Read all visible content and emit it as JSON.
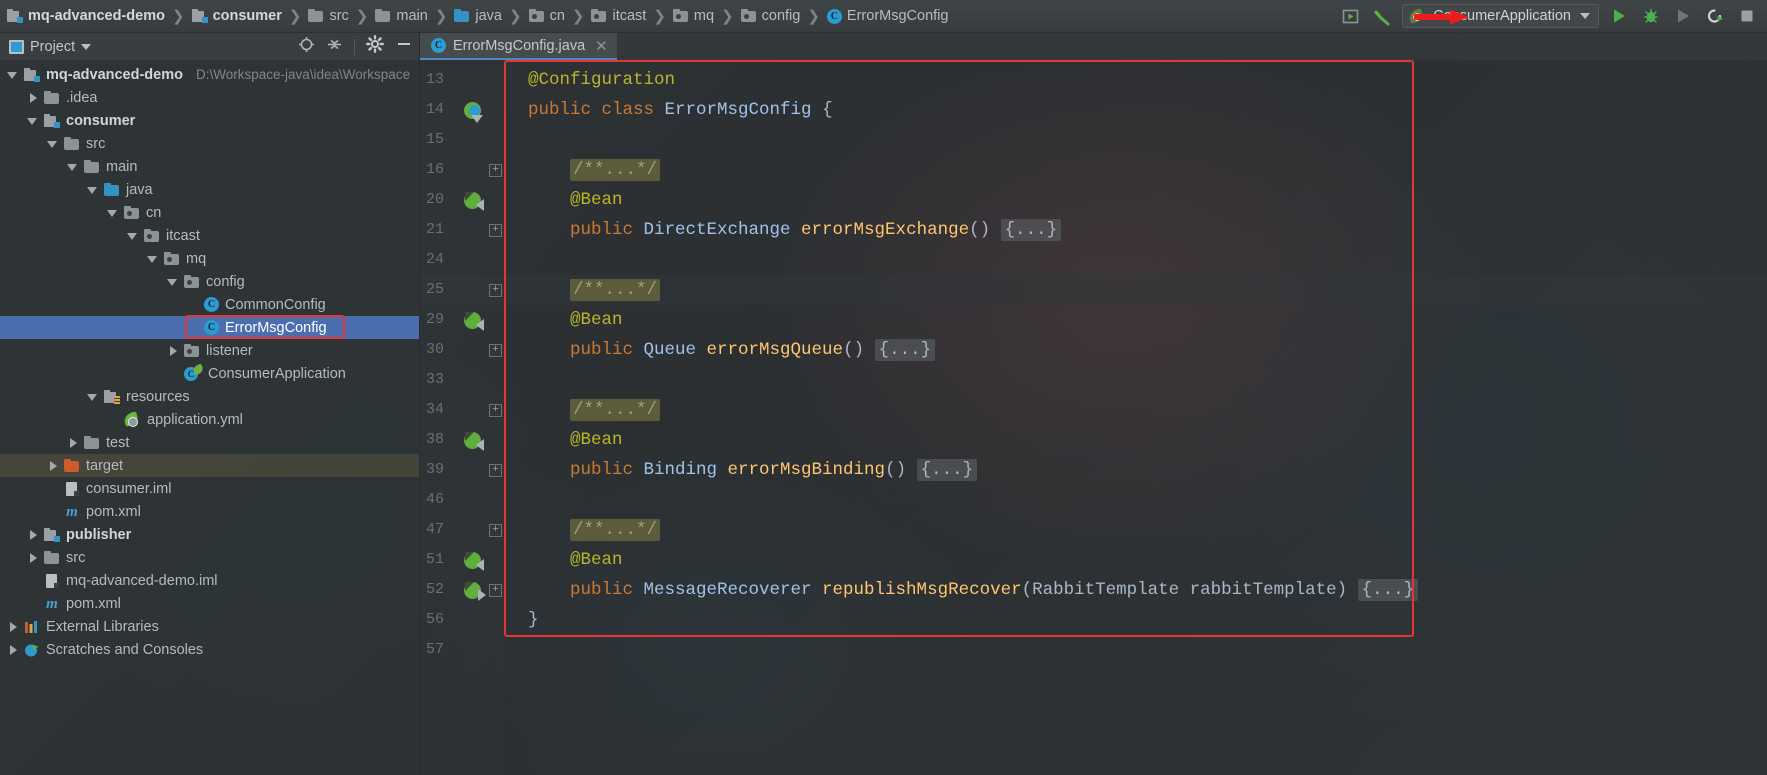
{
  "window": {
    "theme_bg": "#3c3f41",
    "accent": "#4b6eaf",
    "annotation_color": "#e53535"
  },
  "breadcrumb": {
    "items": [
      {
        "label": "mq-advanced-demo",
        "icon": "module-icon",
        "bold": true
      },
      {
        "label": "consumer",
        "icon": "module-icon",
        "bold": true
      },
      {
        "label": "src",
        "icon": "folder-icon",
        "bold": false
      },
      {
        "label": "main",
        "icon": "folder-icon",
        "bold": false
      },
      {
        "label": "java",
        "icon": "source-folder-icon",
        "bold": false
      },
      {
        "label": "cn",
        "icon": "package-icon",
        "bold": false
      },
      {
        "label": "itcast",
        "icon": "package-icon",
        "bold": false
      },
      {
        "label": "mq",
        "icon": "package-icon",
        "bold": false
      },
      {
        "label": "config",
        "icon": "package-icon",
        "bold": false
      },
      {
        "label": "ErrorMsgConfig",
        "icon": "java-class-icon",
        "bold": false
      }
    ],
    "separator": "❯"
  },
  "toolbar": {
    "icons": [
      {
        "name": "search-everywhere-icon",
        "glyph": "▶"
      },
      {
        "name": "build-hammer-icon",
        "glyph": "↖"
      }
    ],
    "run_configuration": {
      "name": "ConsumerApplication",
      "icon": "spring-boot-icon",
      "dropdown_caret": "▼"
    },
    "buttons": [
      {
        "name": "run-button",
        "glyph": "▶",
        "color": "#4caf50"
      },
      {
        "name": "debug-button",
        "glyph": "🐞",
        "color": "#4caf50"
      },
      {
        "name": "run-with-coverage-button",
        "glyph": "▶",
        "color": "#7a7f82"
      },
      {
        "name": "profiler-button",
        "glyph": "↻",
        "color": "#cfd4d7"
      },
      {
        "name": "stop-button",
        "glyph": "■",
        "color": "#9aa0a4"
      }
    ],
    "annotation": "red-arrow-pointing-to-run-button"
  },
  "project_panel": {
    "title": "Project",
    "header_icons": [
      {
        "name": "locate-target-icon"
      },
      {
        "name": "collapse-all-icon"
      },
      {
        "name": "gear-settings-icon"
      },
      {
        "name": "hide-panel-icon"
      }
    ],
    "tree": [
      {
        "label": "mq-advanced-demo",
        "path_hint": "D:\\Workspace-java\\idea\\Workspace",
        "depth": 0,
        "icon": "module-icon",
        "state": "open",
        "bold": true,
        "selected": false
      },
      {
        "label": ".idea",
        "depth": 1,
        "icon": "folder-icon",
        "state": "closed",
        "bold": false,
        "selected": false
      },
      {
        "label": "consumer",
        "depth": 1,
        "icon": "module-icon",
        "state": "open",
        "bold": true,
        "selected": false
      },
      {
        "label": "src",
        "depth": 2,
        "icon": "folder-icon",
        "state": "open",
        "bold": false,
        "selected": false
      },
      {
        "label": "main",
        "depth": 3,
        "icon": "folder-icon",
        "state": "open",
        "bold": false,
        "selected": false
      },
      {
        "label": "java",
        "depth": 4,
        "icon": "source-folder-icon",
        "state": "open",
        "bold": false,
        "selected": false
      },
      {
        "label": "cn",
        "depth": 5,
        "icon": "package-icon",
        "state": "open",
        "bold": false,
        "selected": false
      },
      {
        "label": "itcast",
        "depth": 6,
        "icon": "package-icon",
        "state": "open",
        "bold": false,
        "selected": false
      },
      {
        "label": "mq",
        "depth": 7,
        "icon": "package-icon",
        "state": "open",
        "bold": false,
        "selected": false
      },
      {
        "label": "config",
        "depth": 8,
        "icon": "package-icon",
        "state": "open",
        "bold": false,
        "selected": false
      },
      {
        "label": "CommonConfig",
        "depth": 9,
        "icon": "java-class-icon",
        "state": "leaf",
        "bold": false,
        "selected": false
      },
      {
        "label": "ErrorMsgConfig",
        "depth": 9,
        "icon": "java-class-icon",
        "state": "leaf",
        "bold": false,
        "selected": true,
        "annotated": true
      },
      {
        "label": "listener",
        "depth": 8,
        "icon": "package-icon",
        "state": "closed",
        "bold": false,
        "selected": false
      },
      {
        "label": "ConsumerApplication",
        "depth": 8,
        "icon": "spring-class-icon",
        "state": "leaf",
        "bold": false,
        "selected": false
      },
      {
        "label": "resources",
        "depth": 4,
        "icon": "resources-folder-icon",
        "state": "open",
        "bold": false,
        "selected": false
      },
      {
        "label": "application.yml",
        "depth": 5,
        "icon": "spring-yaml-icon",
        "state": "leaf",
        "bold": false,
        "selected": false
      },
      {
        "label": "test",
        "depth": 3,
        "icon": "folder-icon",
        "state": "closed",
        "bold": false,
        "selected": false
      },
      {
        "label": "target",
        "depth": 2,
        "icon": "excluded-folder-icon",
        "state": "closed",
        "bold": false,
        "selected": false,
        "hovered": true
      },
      {
        "label": "consumer.iml",
        "depth": 2,
        "icon": "iml-file-icon",
        "state": "leaf",
        "bold": false,
        "selected": false
      },
      {
        "label": "pom.xml",
        "depth": 2,
        "icon": "maven-icon",
        "state": "leaf",
        "bold": false,
        "selected": false
      },
      {
        "label": "publisher",
        "depth": 1,
        "icon": "module-icon",
        "state": "closed",
        "bold": true,
        "selected": false
      },
      {
        "label": "src",
        "depth": 1,
        "icon": "folder-icon",
        "state": "closed",
        "bold": false,
        "selected": false
      },
      {
        "label": "mq-advanced-demo.iml",
        "depth": 1,
        "icon": "iml-file-icon",
        "state": "leaf",
        "bold": false,
        "selected": false
      },
      {
        "label": "pom.xml",
        "depth": 1,
        "icon": "maven-icon",
        "state": "leaf",
        "bold": false,
        "selected": false
      },
      {
        "label": "External Libraries",
        "depth": 0,
        "icon": "libraries-icon",
        "state": "closed",
        "bold": false,
        "selected": false
      },
      {
        "label": "Scratches and Consoles",
        "depth": 0,
        "icon": "scratches-icon",
        "state": "closed",
        "bold": false,
        "selected": false
      }
    ]
  },
  "editor": {
    "tabs": [
      {
        "label": "ErrorMsgConfig.java",
        "icon": "java-class-icon",
        "active": true,
        "close_glyph": "✕"
      }
    ],
    "annotation": "red-rectangle-around-code-block",
    "lines": [
      {
        "num": "13",
        "gutter": "",
        "fold": false,
        "bulb": false,
        "highlight": false,
        "indent": 0,
        "tokens": [
          {
            "t": "@Configuration",
            "c": "ann"
          }
        ]
      },
      {
        "num": "14",
        "gutter": "run-class-icon",
        "fold": false,
        "bulb": false,
        "highlight": false,
        "indent": 0,
        "tokens": [
          {
            "t": "public ",
            "c": "kw"
          },
          {
            "t": "class ",
            "c": "kw"
          },
          {
            "t": "ErrorMsgConfig",
            "c": "cls"
          },
          {
            "t": " {",
            "c": "pun"
          }
        ]
      },
      {
        "num": "15",
        "gutter": "",
        "fold": false,
        "bulb": false,
        "highlight": false,
        "indent": 0,
        "tokens": []
      },
      {
        "num": "16",
        "gutter": "",
        "fold": true,
        "bulb": false,
        "highlight": false,
        "indent": 1,
        "tokens": [
          {
            "t": "/**...*/",
            "c": "fold-ph"
          }
        ]
      },
      {
        "num": "20",
        "gutter": "nav-left-icon",
        "fold": false,
        "bulb": false,
        "highlight": false,
        "indent": 1,
        "tokens": [
          {
            "t": "@Bean",
            "c": "ann"
          }
        ]
      },
      {
        "num": "21",
        "gutter": "",
        "fold": true,
        "bulb": false,
        "highlight": false,
        "indent": 1,
        "tokens": [
          {
            "t": "public ",
            "c": "kw"
          },
          {
            "t": "DirectExchange ",
            "c": "cls"
          },
          {
            "t": "errorMsgExchange",
            "c": "mth"
          },
          {
            "t": "() ",
            "c": "pun"
          },
          {
            "t": "{...}",
            "c": "fold-brace"
          }
        ]
      },
      {
        "num": "24",
        "gutter": "",
        "fold": false,
        "bulb": false,
        "highlight": false,
        "indent": 0,
        "tokens": []
      },
      {
        "num": "25",
        "gutter": "",
        "fold": true,
        "bulb": true,
        "highlight": true,
        "indent": 1,
        "tokens": [
          {
            "t": "/**...*/",
            "c": "fold-ph"
          }
        ]
      },
      {
        "num": "29",
        "gutter": "nav-left-icon",
        "fold": false,
        "bulb": false,
        "highlight": false,
        "indent": 1,
        "tokens": [
          {
            "t": "@Bean",
            "c": "ann"
          }
        ]
      },
      {
        "num": "30",
        "gutter": "",
        "fold": true,
        "bulb": false,
        "highlight": false,
        "indent": 1,
        "tokens": [
          {
            "t": "public ",
            "c": "kw"
          },
          {
            "t": "Queue ",
            "c": "cls"
          },
          {
            "t": "errorMsgQueue",
            "c": "mth"
          },
          {
            "t": "() ",
            "c": "pun"
          },
          {
            "t": "{...}",
            "c": "fold-brace"
          }
        ]
      },
      {
        "num": "33",
        "gutter": "",
        "fold": false,
        "bulb": false,
        "highlight": false,
        "indent": 0,
        "tokens": []
      },
      {
        "num": "34",
        "gutter": "",
        "fold": true,
        "bulb": false,
        "highlight": false,
        "indent": 1,
        "tokens": [
          {
            "t": "/**...*/",
            "c": "fold-ph"
          }
        ]
      },
      {
        "num": "38",
        "gutter": "nav-left-icon",
        "fold": false,
        "bulb": false,
        "highlight": false,
        "indent": 1,
        "tokens": [
          {
            "t": "@Bean",
            "c": "ann"
          }
        ]
      },
      {
        "num": "39",
        "gutter": "",
        "fold": true,
        "bulb": false,
        "highlight": false,
        "indent": 1,
        "tokens": [
          {
            "t": "public ",
            "c": "kw"
          },
          {
            "t": "Binding ",
            "c": "cls"
          },
          {
            "t": "errorMsgBinding",
            "c": "mth"
          },
          {
            "t": "() ",
            "c": "pun"
          },
          {
            "t": "{...}",
            "c": "fold-brace"
          }
        ]
      },
      {
        "num": "46",
        "gutter": "",
        "fold": false,
        "bulb": false,
        "highlight": false,
        "indent": 0,
        "tokens": []
      },
      {
        "num": "47",
        "gutter": "",
        "fold": true,
        "bulb": false,
        "highlight": false,
        "indent": 1,
        "tokens": [
          {
            "t": "/**...*/",
            "c": "fold-ph"
          }
        ]
      },
      {
        "num": "51",
        "gutter": "nav-left-icon",
        "fold": false,
        "bulb": false,
        "highlight": false,
        "indent": 1,
        "tokens": [
          {
            "t": "@Bean",
            "c": "ann"
          }
        ]
      },
      {
        "num": "52",
        "gutter": "nav-right-icon",
        "fold": true,
        "bulb": false,
        "highlight": false,
        "indent": 1,
        "tokens": [
          {
            "t": "public ",
            "c": "kw"
          },
          {
            "t": "MessageRecoverer ",
            "c": "cls"
          },
          {
            "t": "republishMsgRecover",
            "c": "mth"
          },
          {
            "t": "(RabbitTemplate rabbitTemplate) ",
            "c": "pun"
          },
          {
            "t": "{...}",
            "c": "fold-brace"
          }
        ]
      },
      {
        "num": "56",
        "gutter": "",
        "fold": false,
        "bulb": false,
        "highlight": false,
        "indent": 0,
        "tokens": [
          {
            "t": "}",
            "c": "pun"
          }
        ]
      },
      {
        "num": "57",
        "gutter": "",
        "fold": false,
        "bulb": false,
        "highlight": false,
        "indent": 0,
        "tokens": []
      }
    ]
  }
}
